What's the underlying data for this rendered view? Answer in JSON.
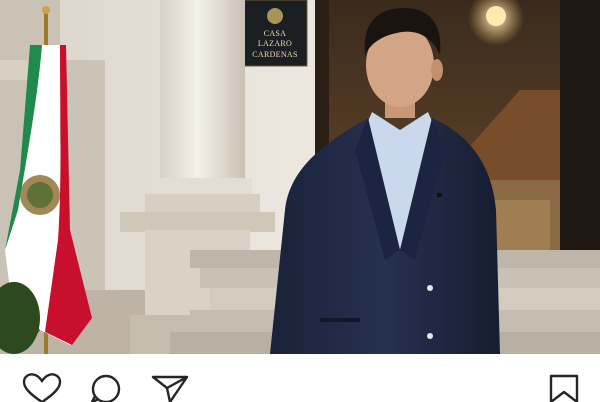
{
  "post": {
    "plaque": {
      "line1": "CASA",
      "line2": "LAZARO",
      "line3": "CARDENAS"
    }
  },
  "actions": {
    "like_icon": "heart-icon",
    "comment_icon": "comment-icon",
    "share_icon": "paper-plane-icon",
    "save_icon": "bookmark-icon"
  },
  "colors": {
    "icon": "#262626",
    "background": "#ffffff",
    "suit": "#1f2a44",
    "shirt": "#c9d8ec",
    "flag_green": "#1f8a4c",
    "flag_red": "#c8102e"
  }
}
